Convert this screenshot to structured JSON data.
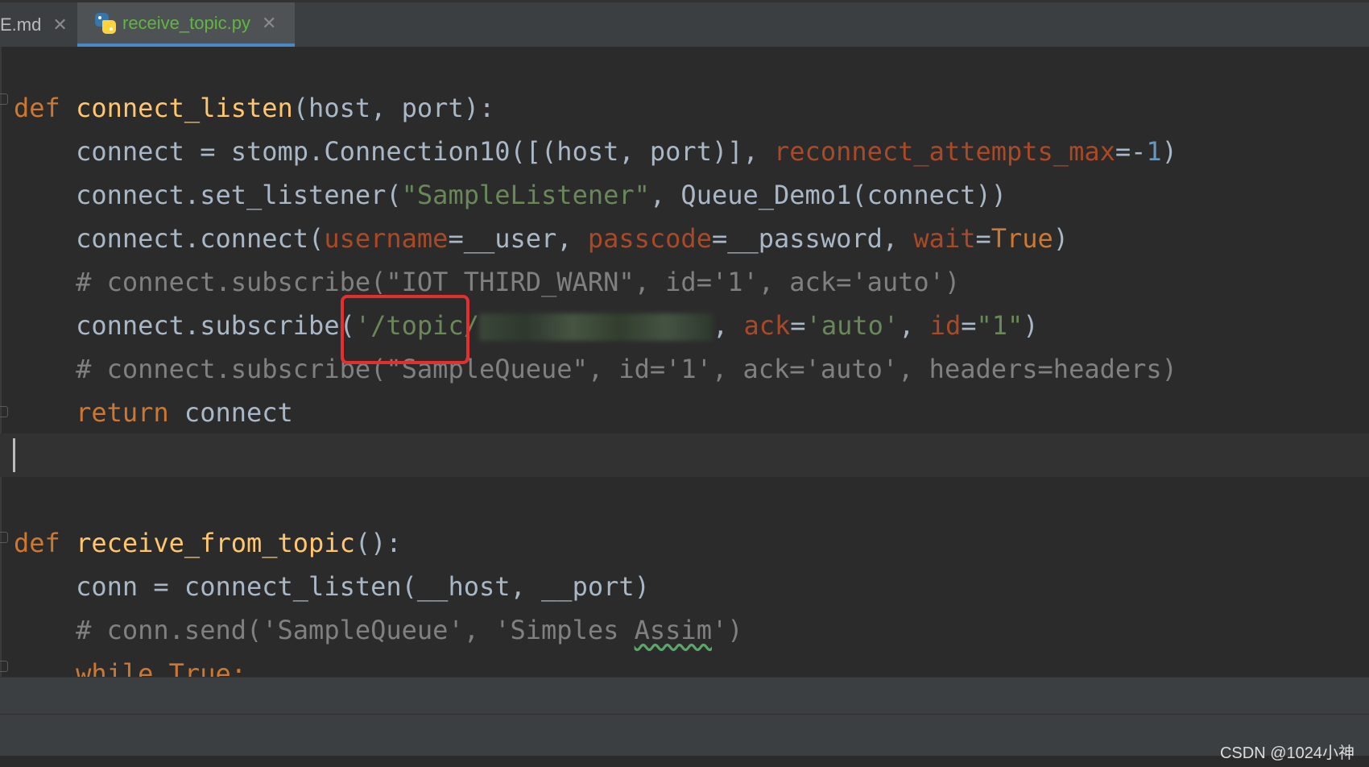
{
  "tabs": [
    {
      "label": "E.md",
      "active": false
    },
    {
      "label": "receive_topic.py",
      "active": true
    }
  ],
  "code": {
    "l1_kw": "def",
    "l1_fn": "connect_listen",
    "l1_rest": "(host, port):",
    "l2_a": "    connect = stomp.Connection10([(host, port)], ",
    "l2_pn": "reconnect_attempts_max",
    "l2_b": "=-",
    "l2_num": "1",
    "l2_c": ")",
    "l3_a": "    connect.set_listener(",
    "l3_str": "\"SampleListener\"",
    "l3_b": ", Queue_Demo1(connect))",
    "l4_a": "    connect.connect(",
    "l4_p1": "username",
    "l4_b": "=__user, ",
    "l4_p2": "passcode",
    "l4_c": "=__password, ",
    "l4_p3": "wait",
    "l4_d": "=",
    "l4_kw": "True",
    "l4_e": ")",
    "l5_cm": "    # connect.subscribe(\"IOT_THIRD_WARN\", id='1', ack='auto')",
    "l6_a": "    connect.subscribe(",
    "l6_str": "'/topic/",
    "l6_b": ", ",
    "l6_p1": "ack",
    "l6_c": "=",
    "l6_str2": "'auto'",
    "l6_d": ", ",
    "l6_p2": "id",
    "l6_e": "=",
    "l6_str3": "\"1\"",
    "l6_f": ")",
    "l7_cm": "    # connect.subscribe(\"SampleQueue\", id='1', ack='auto', headers=headers)",
    "l8_kw": "    return",
    "l8_rest": " connect",
    "l9_kw": "def",
    "l9_fn": "receive_from_topic",
    "l9_rest": "():",
    "l10": "    conn = connect_listen(__host, __port)",
    "l11_a": "    # conn.send('SampleQueue', 'Simples ",
    "l11_sq": "Assim",
    "l11_b": "')",
    "l12_kw": "    while True:"
  },
  "colors": {
    "keyword": "#cc7832",
    "function": "#ffc66d",
    "param": "#aa4926",
    "number": "#6897bb",
    "string": "#6a8759",
    "comment": "#808080",
    "text": "#a9b7c6",
    "highlight_box": "#e62e2e"
  },
  "watermark": "CSDN @1024小神"
}
